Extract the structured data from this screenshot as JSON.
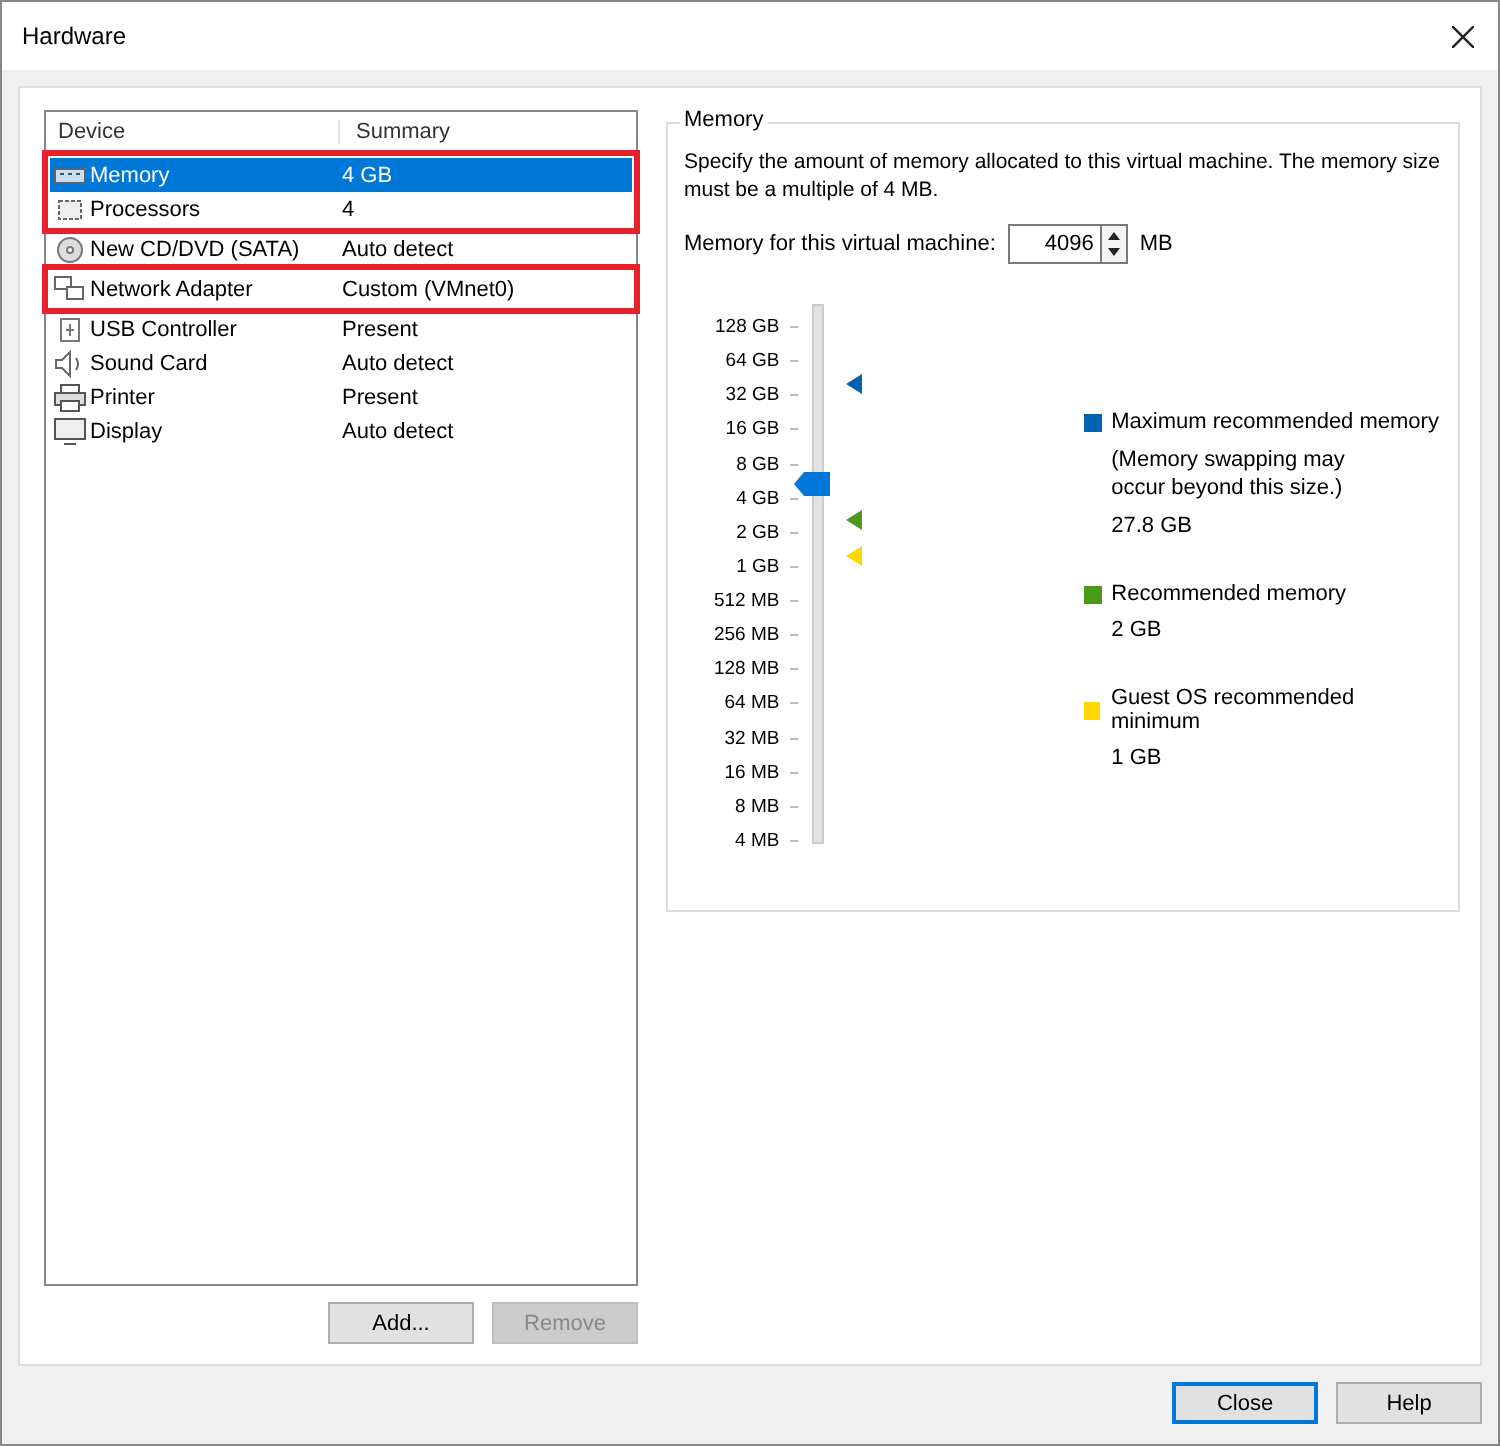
{
  "window": {
    "title": "Hardware"
  },
  "device_list": {
    "columns": [
      "Device",
      "Summary"
    ],
    "rows": [
      {
        "kind": "memory",
        "device": "Memory",
        "summary": "4 GB",
        "selected": true,
        "boxed": true
      },
      {
        "kind": "processor",
        "device": "Processors",
        "summary": "4",
        "selected": false,
        "boxed": true
      },
      {
        "kind": "cdrom",
        "device": "New CD/DVD (SATA)",
        "summary": "Auto detect",
        "selected": false,
        "boxed": false
      },
      {
        "kind": "network",
        "device": "Network Adapter",
        "summary": "Custom (VMnet0)",
        "selected": false,
        "boxed": true
      },
      {
        "kind": "usb",
        "device": "USB Controller",
        "summary": "Present",
        "selected": false,
        "boxed": false
      },
      {
        "kind": "sound",
        "device": "Sound Card",
        "summary": "Auto detect",
        "selected": false,
        "boxed": false
      },
      {
        "kind": "printer",
        "device": "Printer",
        "summary": "Present",
        "selected": false,
        "boxed": false
      },
      {
        "kind": "display",
        "device": "Display",
        "summary": "Auto detect",
        "selected": false,
        "boxed": false
      }
    ]
  },
  "list_buttons": [
    {
      "label": "Add...",
      "disabled": false
    },
    {
      "label": "Remove",
      "disabled": true
    }
  ],
  "memory": {
    "title": "Memory",
    "description": "Specify the amount of memory allocated to this virtual machine. The memory size must be a multiple of 4 MB.",
    "field_label": "Memory for this virtual machine:",
    "value": "4096",
    "unit": "MB",
    "scale": [
      "128 GB",
      "64 GB",
      "32 GB",
      "16 GB",
      "8 GB",
      "4 GB",
      "2 GB",
      "1 GB",
      "512 MB",
      "256 MB",
      "128 MB",
      "64 MB",
      "32 MB",
      "16 MB",
      "8 MB",
      "4 MB"
    ],
    "slider": {
      "level": 0.667,
      "markers": [
        {
          "color": "#0063b1",
          "level": 0.853
        },
        {
          "color": "#4a9a1a",
          "level": 0.6
        },
        {
          "color": "#ffd800",
          "level": 0.533
        }
      ]
    },
    "legend": [
      {
        "label": "Maximum recommended memory",
        "note": "(Memory swapping may occur beyond this size.)",
        "value": "27.8 GB",
        "color": "#0063b1"
      },
      {
        "label": "Recommended memory",
        "value": "2 GB",
        "color": "#4a9a1a"
      },
      {
        "label": "Guest OS recommended minimum",
        "value": "1 GB",
        "color": "#ffd800"
      }
    ]
  },
  "footer_buttons": [
    {
      "label": "Close",
      "default": true
    },
    {
      "label": "Help",
      "default": false
    }
  ]
}
